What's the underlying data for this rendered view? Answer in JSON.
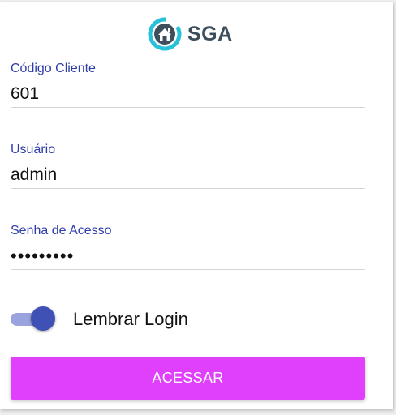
{
  "brand": {
    "name": "SGA",
    "logo_icon": "house-ring-icon",
    "ring_color": "#29c1d9",
    "house_color": "#3d4f5c"
  },
  "form": {
    "client_code": {
      "label": "Código Cliente",
      "value": "601"
    },
    "user": {
      "label": "Usuário",
      "value": "admin"
    },
    "password": {
      "label": "Senha de Acesso",
      "value": "secret123"
    },
    "remember": {
      "label": "Lembrar Login",
      "checked": true
    },
    "submit_label": "ACESSAR"
  },
  "colors": {
    "label": "#2f3da8",
    "toggle_thumb": "#3f51b5",
    "toggle_track": "#9ba3de",
    "button": "#e040fb"
  }
}
